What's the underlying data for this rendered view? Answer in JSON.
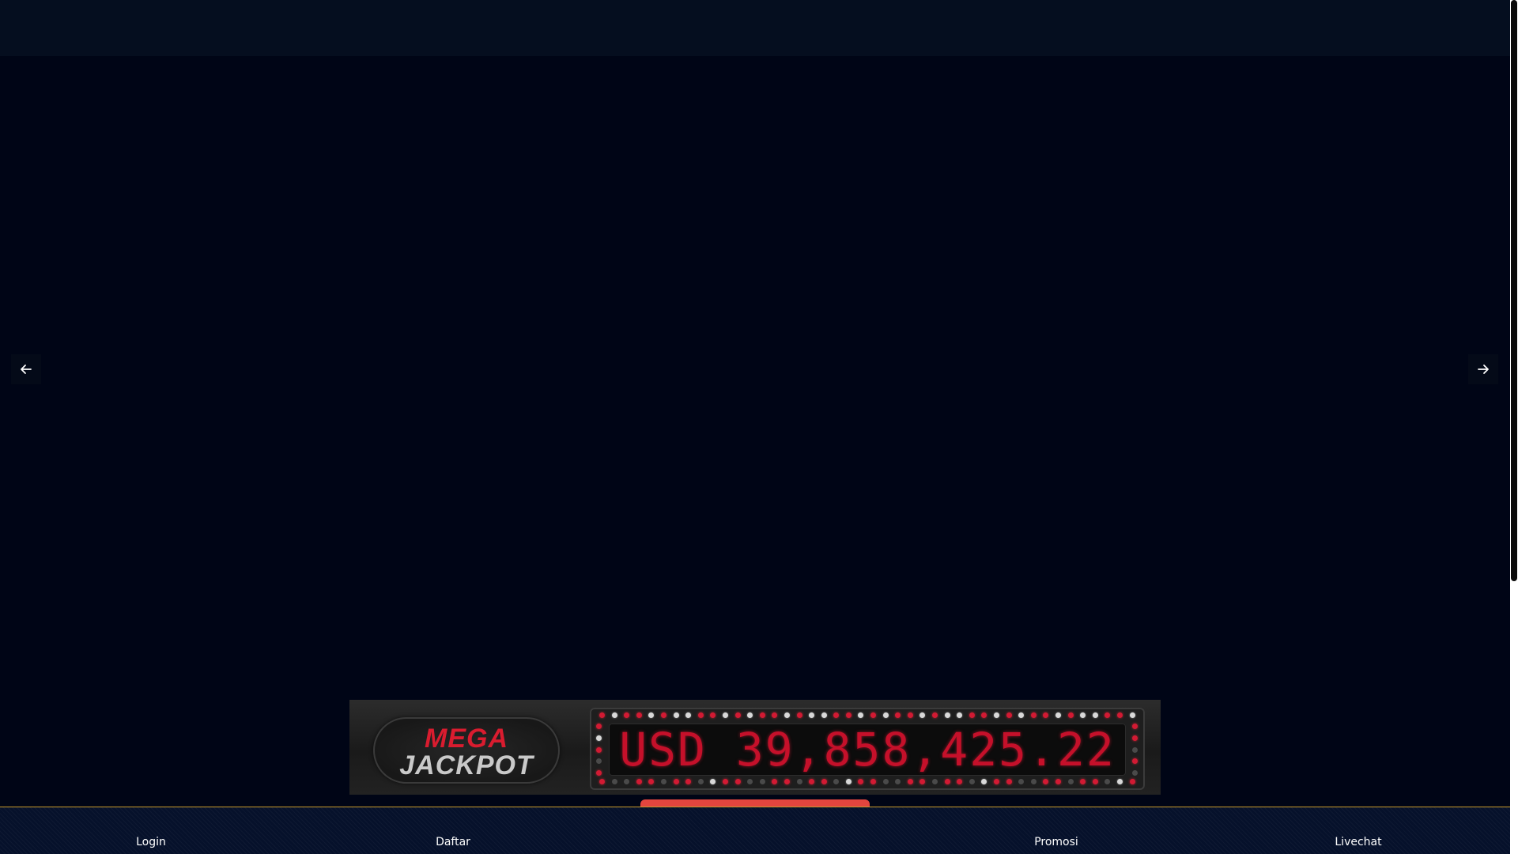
{
  "jackpot": {
    "logo_line1": "MEGA",
    "logo_line2": "JACKPOT",
    "amount": "USD 39,858,425.22",
    "colors": {
      "mega_text": "#d91c2f",
      "jackpot_text": "#c9c9c9",
      "led_red": "#c5102a"
    }
  },
  "slider": {
    "prev_icon": "arrow-left-icon",
    "next_icon": "arrow-right-icon"
  },
  "bottom_nav": {
    "items": [
      {
        "label": "Login"
      },
      {
        "label": "Daftar"
      },
      {
        "label": "Promosi"
      },
      {
        "label": "Livechat"
      }
    ],
    "accent_border": "#c79a2b"
  },
  "colors": {
    "page_background": "#000516",
    "header_background": "#050e1f",
    "nav_background": "#06112b",
    "center_tab": "#e2453e"
  }
}
